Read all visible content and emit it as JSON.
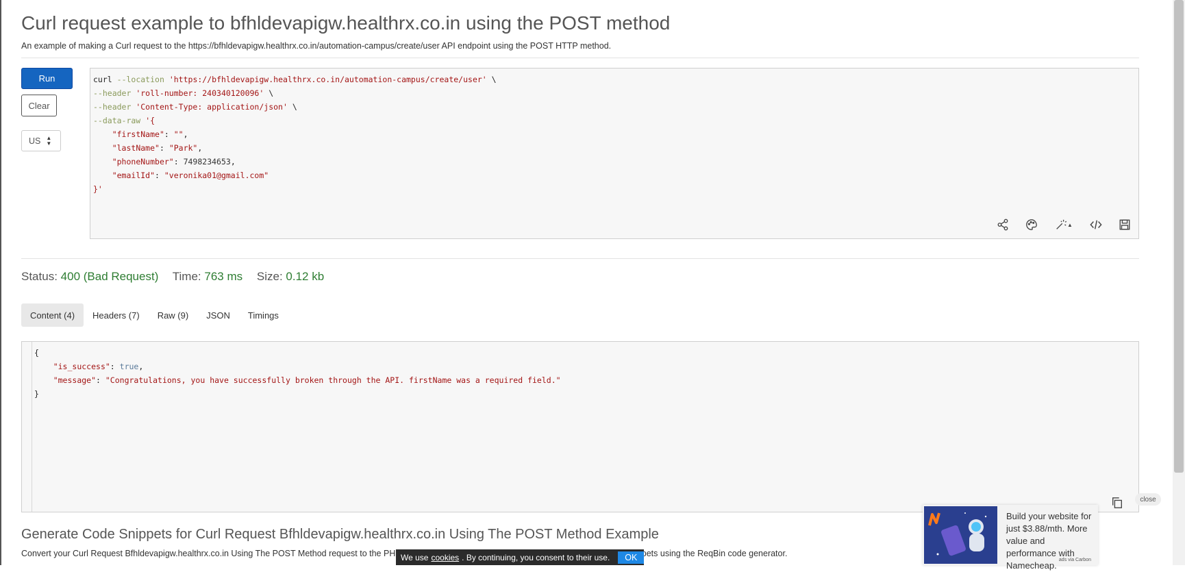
{
  "header": {
    "title": "Curl request example to bfhldevapigw.healthrx.co.in using the POST method",
    "subtitle": "An example of making a Curl request to the https://bfhldevapigw.healthrx.co.in/automation-campus/create/user API endpoint using the POST HTTP method."
  },
  "actions": {
    "run_label": "Run",
    "clear_label": "Clear",
    "region_value": "US"
  },
  "request": {
    "lines": {
      "l1_cmd": "curl",
      "l1_flag": "--location",
      "l1_url": "'https://bfhldevapigw.healthrx.co.in/automation-campus/create/user'",
      "l1_end": "\\",
      "l2_flag": "--header",
      "l2_val": "'roll-number: 240340120096'",
      "l2_end": "\\",
      "l3_flag": "--header",
      "l3_val": "'Content-Type: application/json'",
      "l3_end": "\\",
      "l4_flag": "--data-raw",
      "l4_val": "'{",
      "k1": "\"firstName\"",
      "v1": "\"\"",
      "k2": "\"lastName\"",
      "v2": "\"Park\"",
      "k3": "\"phoneNumber\"",
      "v3": "7498234653",
      "k4": "\"emailId\"",
      "v4": "\"veronika01@gmail.com\"",
      "close": "}'"
    },
    "toolbar_icons": [
      "share-icon",
      "palette-icon",
      "magic-wand-icon",
      "code-icon",
      "save-icon"
    ]
  },
  "response": {
    "status_label": "Status:",
    "status_value": "400 (Bad Request)",
    "time_label": "Time:",
    "time_value": "763 ms",
    "size_label": "Size:",
    "size_value": "0.12 kb",
    "status_color": "#2e7d32",
    "tabs": [
      {
        "label": "Content (4)"
      },
      {
        "label": "Headers (7)"
      },
      {
        "label": "Raw (9)"
      },
      {
        "label": "JSON"
      },
      {
        "label": "Timings"
      }
    ],
    "body": {
      "open": "{",
      "k1": "\"is_success\"",
      "v1": "true",
      "k2": "\"message\"",
      "v2": "\"Congratulations, you have successfully broken through the API. firstName was a required field.\"",
      "close": "}"
    }
  },
  "generate": {
    "heading": "Generate Code Snippets for Curl Request Bfhldevapigw.healthrx.co.in Using The POST Method Example",
    "text": "Convert your Curl Request Bfhldevapigw.healthrx.co.in Using The POST Method request to the PHP, JavaScript/AJAX, Curl/Bash, Python, Java, C#/.NET code snippets using the ReqBin code generator."
  },
  "cookie_banner": {
    "text_before": "We use",
    "link": "cookies",
    "text_after": ". By continuing, you consent to their use.",
    "ok_label": "OK"
  },
  "ad": {
    "text": "Build your website for just $3.88/mth. More value and performance with Namecheap.",
    "via": "ads via Carbon",
    "close_label": "close"
  },
  "colors": {
    "accent": "#1565c0",
    "success": "#2e7d32"
  }
}
